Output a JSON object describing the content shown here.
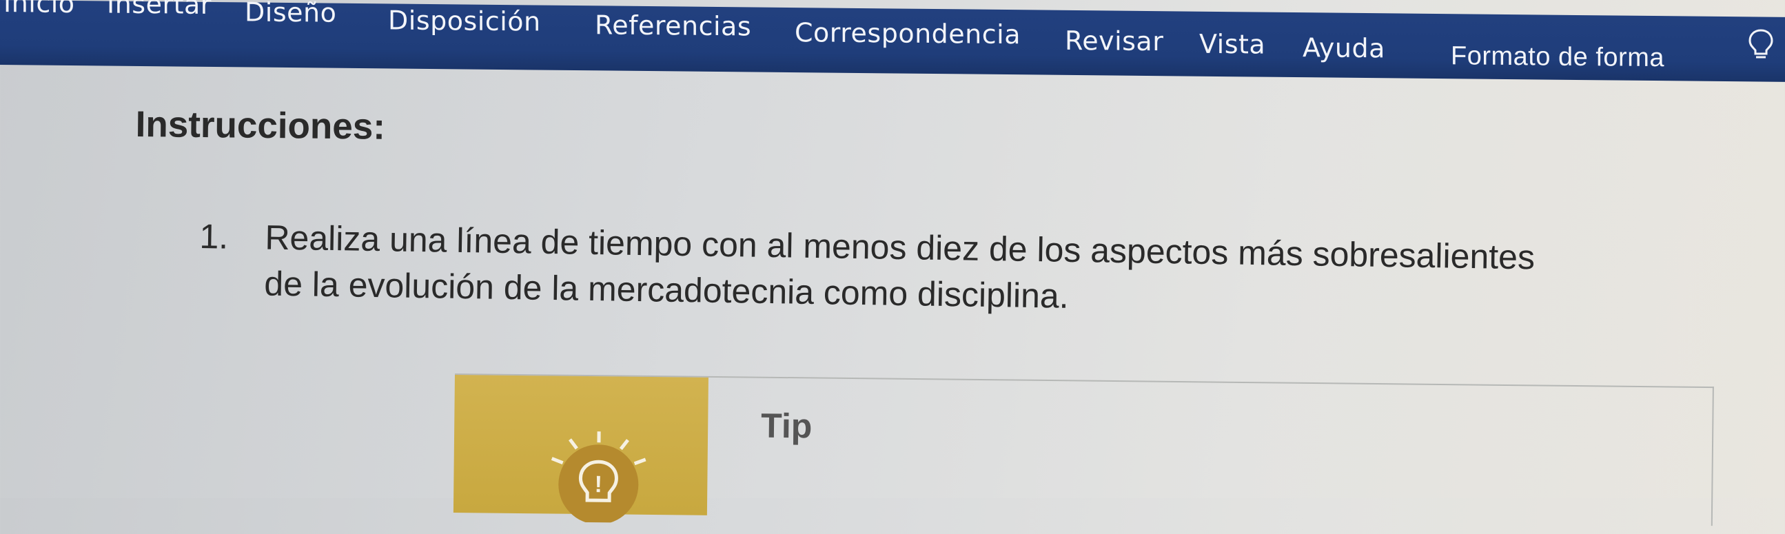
{
  "ribbon": {
    "tabs": [
      {
        "label": "Inicio"
      },
      {
        "label": "Insertar"
      },
      {
        "label": "Diseño"
      },
      {
        "label": "Disposición"
      },
      {
        "label": "Referencias"
      },
      {
        "label": "Correspondencia"
      },
      {
        "label": "Revisar"
      },
      {
        "label": "Vista"
      },
      {
        "label": "Ayuda"
      },
      {
        "label": "Formato de forma"
      }
    ],
    "tell_me_icon": "lightbulb-icon",
    "color": "#1f3d7a"
  },
  "document": {
    "heading": "Instrucciones:",
    "items": [
      {
        "number": "1.",
        "text": "Realiza una línea de tiempo con al menos diez de los aspectos más sobresalientes de la evolución de la mercadotecnia como disciplina."
      }
    ],
    "tip": {
      "label": "Tip",
      "icon": "lightbulb-icon",
      "accent_color": "#c9aa44"
    }
  }
}
